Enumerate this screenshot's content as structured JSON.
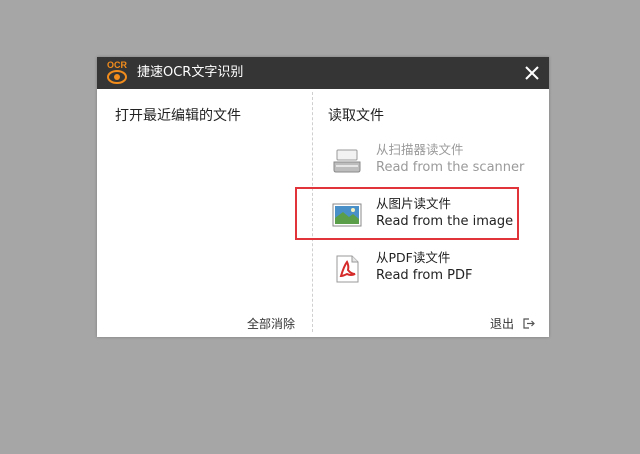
{
  "window": {
    "logo_text": "OCR",
    "title": "捷速OCR文字识别",
    "accent_color": "#f28c1c",
    "titlebar_color": "#353535"
  },
  "left_panel": {
    "heading": "打开最近编辑的文件",
    "clear_all_label": "全部消除"
  },
  "right_panel": {
    "heading": "读取文件",
    "options": [
      {
        "icon": "scanner-icon",
        "label_zh": "从扫描器读文件",
        "label_en": "Read from the scanner",
        "enabled": false
      },
      {
        "icon": "image-icon",
        "label_zh": "从图片读文件",
        "label_en": "Read from the image",
        "enabled": true,
        "highlighted": true
      },
      {
        "icon": "pdf-icon",
        "label_zh": "从PDF读文件",
        "label_en": "Read from PDF",
        "enabled": true
      }
    ],
    "exit_label": "退出",
    "highlight_color": "#e0333a"
  }
}
